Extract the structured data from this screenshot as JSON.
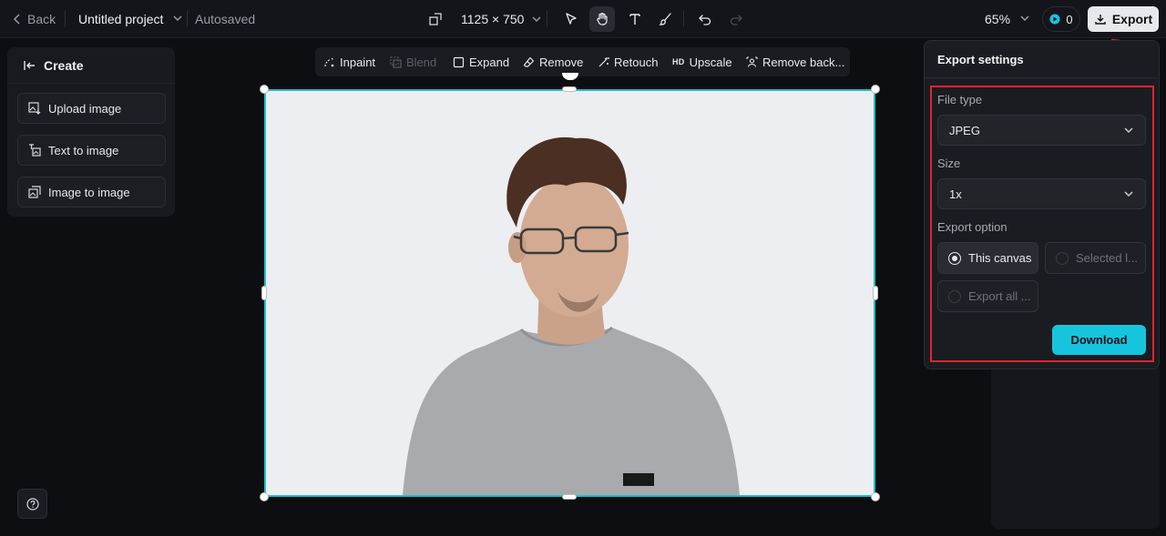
{
  "topbar": {
    "back_label": "Back",
    "project_title": "Untitled project",
    "autosave_status": "Autosaved",
    "canvas_size": "1125 × 750",
    "zoom": "65%",
    "credits": "0",
    "export_label": "Export"
  },
  "left_panel": {
    "header": "Create",
    "buttons": [
      {
        "label": "Upload image",
        "icon": "upload-image-icon"
      },
      {
        "label": "Text to image",
        "icon": "text-to-image-icon"
      },
      {
        "label": "Image to image",
        "icon": "image-to-image-icon"
      }
    ]
  },
  "edit_toolbar": {
    "items": [
      {
        "label": "Inpaint",
        "icon": "inpaint-icon",
        "enabled": true
      },
      {
        "label": "Blend",
        "icon": "blend-icon",
        "enabled": false
      },
      {
        "label": "Expand",
        "icon": "expand-icon",
        "enabled": true
      },
      {
        "label": "Remove",
        "icon": "eraser-icon",
        "enabled": true
      },
      {
        "label": "Retouch",
        "icon": "retouch-icon",
        "enabled": true
      },
      {
        "label": "Upscale",
        "icon": "hd-icon",
        "enabled": true,
        "tag": "HD"
      },
      {
        "label": "Remove back...",
        "icon": "remove-background-icon",
        "enabled": true
      }
    ]
  },
  "export_panel": {
    "title": "Export settings",
    "file_type_label": "File type",
    "file_type_value": "JPEG",
    "size_label": "Size",
    "size_value": "1x",
    "export_option_label": "Export option",
    "options": [
      {
        "label": "This canvas",
        "selected": true
      },
      {
        "label": "Selected l...",
        "selected": false
      },
      {
        "label": "Export all ...",
        "selected": false
      }
    ],
    "download_label": "Download"
  },
  "colors": {
    "accent_cyan": "#16c5dd",
    "selection_border": "#19c2c6",
    "annotation_red": "#e0242f",
    "background": "#0d0e12"
  }
}
